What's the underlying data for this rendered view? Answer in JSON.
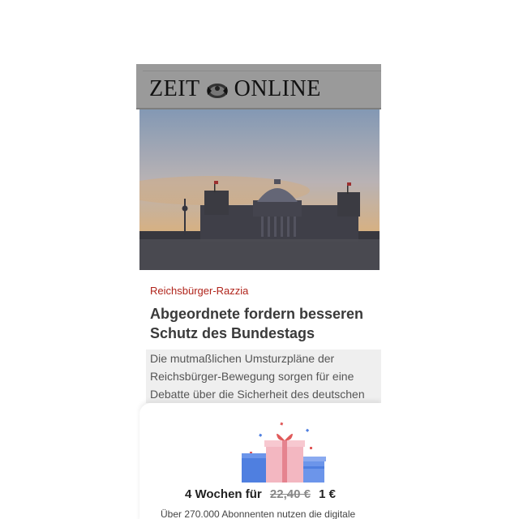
{
  "header": {
    "logo_left": "ZEIT",
    "logo_right": "ONLINE"
  },
  "article": {
    "kicker": "Reichsbürger-Razzia",
    "headline_line1": "Abgeordnete fordern besseren",
    "headline_line2": "Schutz des Bundestags",
    "teaser_line1": "Die mutmaßlichen Umsturzpläne der",
    "teaser_line2": "Reichsbürger-Bewegung sorgen für eine",
    "teaser_line3": "Debatte über die Sicherheit des deutschen"
  },
  "offer": {
    "prefix": "4 Wochen für",
    "old_price": "22,40 €",
    "new_price": "1 €",
    "subline": "Über 270.000 Abonnenten nutzen die digitale"
  },
  "icons": {
    "logo": "eagle-icon",
    "promo": "gift-icon"
  },
  "colors": {
    "kicker": "#b0241b",
    "header_bg": "#9a9a9a"
  }
}
